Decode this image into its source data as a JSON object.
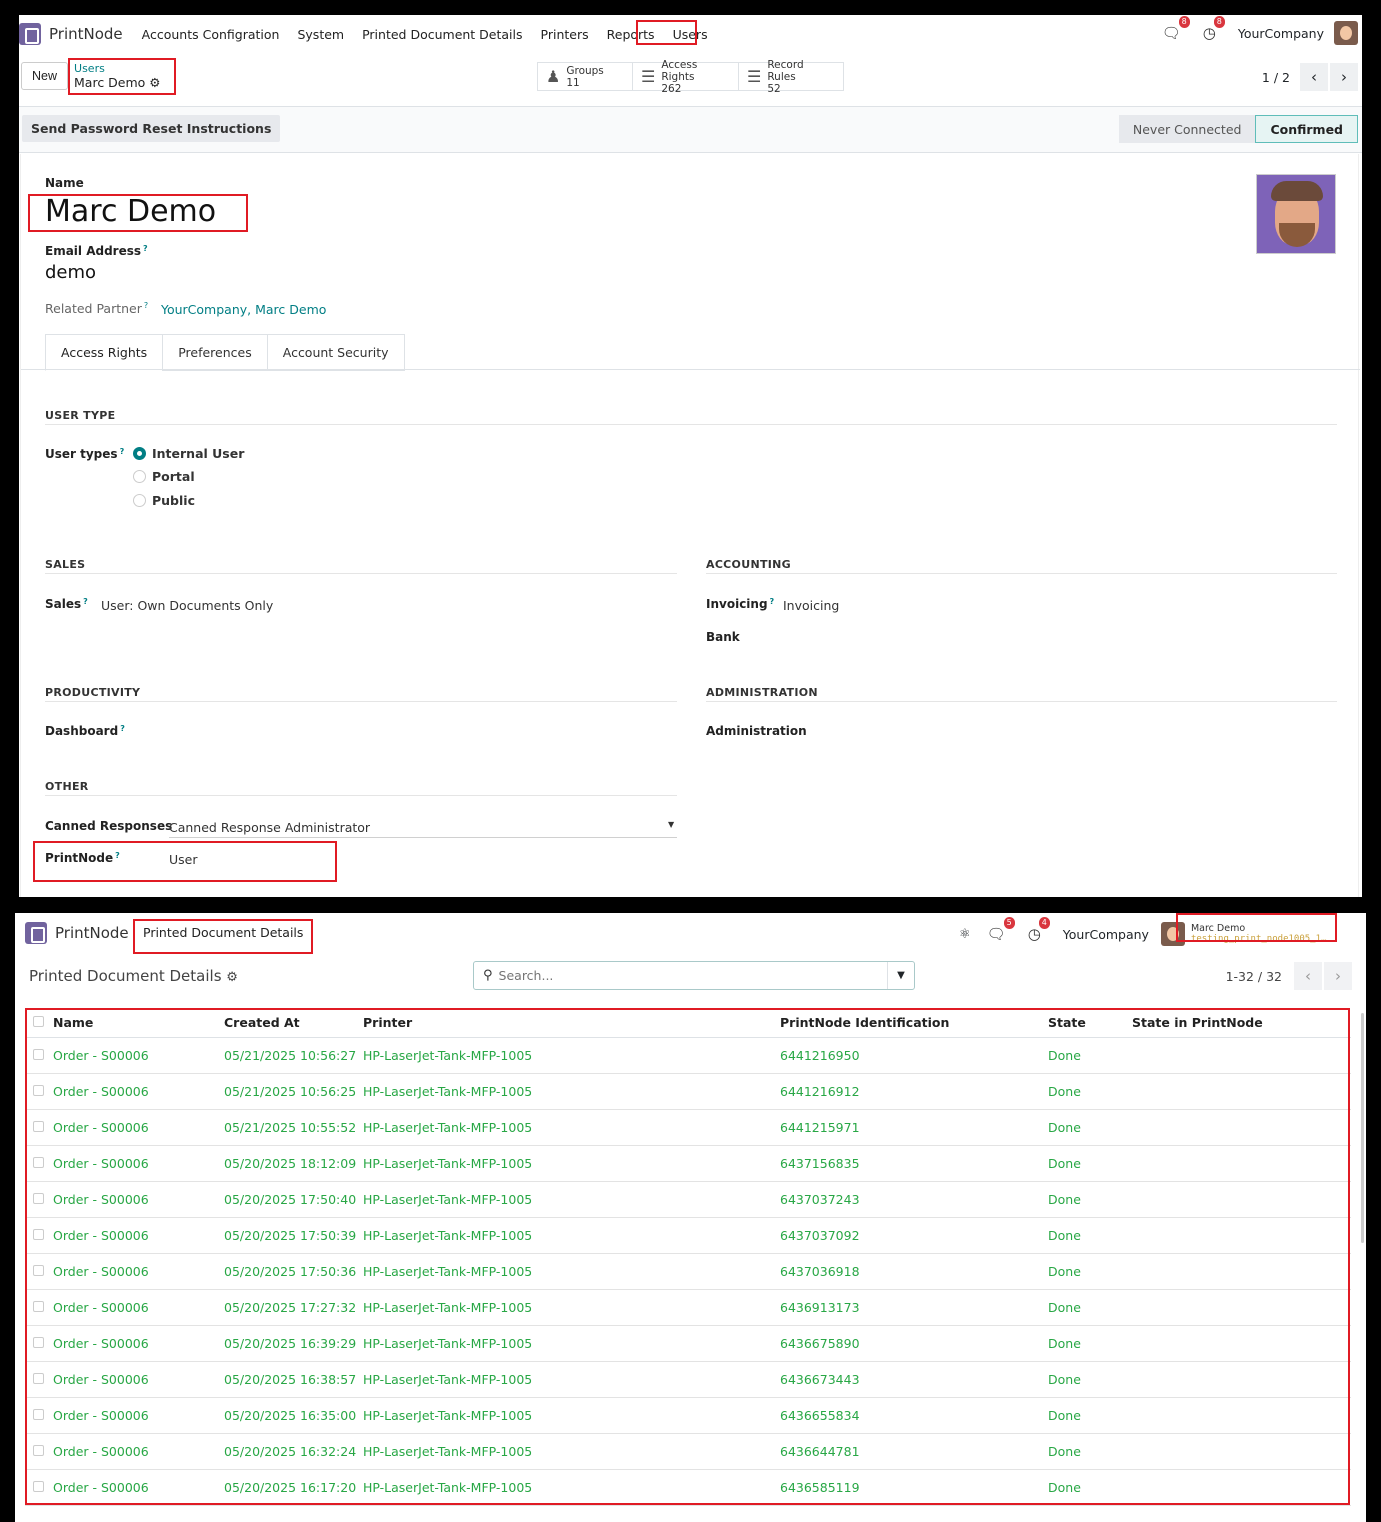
{
  "panel1": {
    "app_name": "PrintNode",
    "menu": [
      "Accounts Configration",
      "System",
      "Printed Document Details",
      "Printers",
      "Reports",
      "Users"
    ],
    "messages_badge": "8",
    "activities_badge": "8",
    "company": "YourCompany",
    "new_button": "New",
    "breadcrumb_parent": "Users",
    "breadcrumb_current": "Marc Demo",
    "smart_buttons": [
      {
        "label": "Groups",
        "value": "11"
      },
      {
        "label": "Access Rights",
        "value": "262"
      },
      {
        "label": "Record Rules",
        "value": "52"
      }
    ],
    "pager": "1 / 2",
    "reset_button": "Send Password Reset Instructions",
    "states": [
      "Never Connected",
      "Confirmed"
    ],
    "name_label": "Name",
    "name_value": "Marc Demo",
    "email_label": "Email Address",
    "email_value": "demo",
    "partner_label": "Related Partner",
    "partner_value": "YourCompany, Marc Demo",
    "tabs": [
      "Access Rights",
      "Preferences",
      "Account Security"
    ],
    "user_type_title": "USER TYPE",
    "user_types_label": "User types",
    "user_types": [
      "Internal User",
      "Portal",
      "Public"
    ],
    "sales_title": "SALES",
    "sales_label": "Sales",
    "sales_value": "User: Own Documents Only",
    "accounting_title": "ACCOUNTING",
    "invoicing_label": "Invoicing",
    "invoicing_value": "Invoicing",
    "bank_label": "Bank",
    "productivity_title": "PRODUCTIVITY",
    "dashboard_label": "Dashboard",
    "administration_title": "ADMINISTRATION",
    "administration_label": "Administration",
    "other_title": "OTHER",
    "canned_label": "Canned Responses",
    "canned_value": "Canned Response Administrator",
    "printnode_label": "PrintNode",
    "printnode_value": "User"
  },
  "panel2": {
    "app_name": "PrintNode",
    "menu_item": "Printed Document Details",
    "messages_badge": "5",
    "activities_badge": "4",
    "company": "YourCompany",
    "user_name": "Marc Demo",
    "user_db": "testing_print_node1005_1…",
    "page_title": "Printed Document Details",
    "search_placeholder": "Search...",
    "pager": "1-32 / 32",
    "columns": [
      "Name",
      "Created At",
      "Printer",
      "PrintNode Identification",
      "State",
      "State in PrintNode"
    ],
    "rows": [
      [
        "Order - S00006",
        "05/21/2025 10:56:27",
        "HP-LaserJet-Tank-MFP-1005",
        "6441216950",
        "Done",
        ""
      ],
      [
        "Order - S00006",
        "05/21/2025 10:56:25",
        "HP-LaserJet-Tank-MFP-1005",
        "6441216912",
        "Done",
        ""
      ],
      [
        "Order - S00006",
        "05/21/2025 10:55:52",
        "HP-LaserJet-Tank-MFP-1005",
        "6441215971",
        "Done",
        ""
      ],
      [
        "Order - S00006",
        "05/20/2025 18:12:09",
        "HP-LaserJet-Tank-MFP-1005",
        "6437156835",
        "Done",
        ""
      ],
      [
        "Order - S00006",
        "05/20/2025 17:50:40",
        "HP-LaserJet-Tank-MFP-1005",
        "6437037243",
        "Done",
        ""
      ],
      [
        "Order - S00006",
        "05/20/2025 17:50:39",
        "HP-LaserJet-Tank-MFP-1005",
        "6437037092",
        "Done",
        ""
      ],
      [
        "Order - S00006",
        "05/20/2025 17:50:36",
        "HP-LaserJet-Tank-MFP-1005",
        "6437036918",
        "Done",
        ""
      ],
      [
        "Order - S00006",
        "05/20/2025 17:27:32",
        "HP-LaserJet-Tank-MFP-1005",
        "6436913173",
        "Done",
        ""
      ],
      [
        "Order - S00006",
        "05/20/2025 16:39:29",
        "HP-LaserJet-Tank-MFP-1005",
        "6436675890",
        "Done",
        ""
      ],
      [
        "Order - S00006",
        "05/20/2025 16:38:57",
        "HP-LaserJet-Tank-MFP-1005",
        "6436673443",
        "Done",
        ""
      ],
      [
        "Order - S00006",
        "05/20/2025 16:35:00",
        "HP-LaserJet-Tank-MFP-1005",
        "6436655834",
        "Done",
        ""
      ],
      [
        "Order - S00006",
        "05/20/2025 16:32:24",
        "HP-LaserJet-Tank-MFP-1005",
        "6436644781",
        "Done",
        ""
      ],
      [
        "Order - S00006",
        "05/20/2025 16:17:20",
        "HP-LaserJet-Tank-MFP-1005",
        "6436585119",
        "Done",
        ""
      ]
    ]
  },
  "colors": {
    "accent": "#017e84",
    "success": "#28a745",
    "highlight": "#e01b24",
    "brand": "#71639e"
  }
}
